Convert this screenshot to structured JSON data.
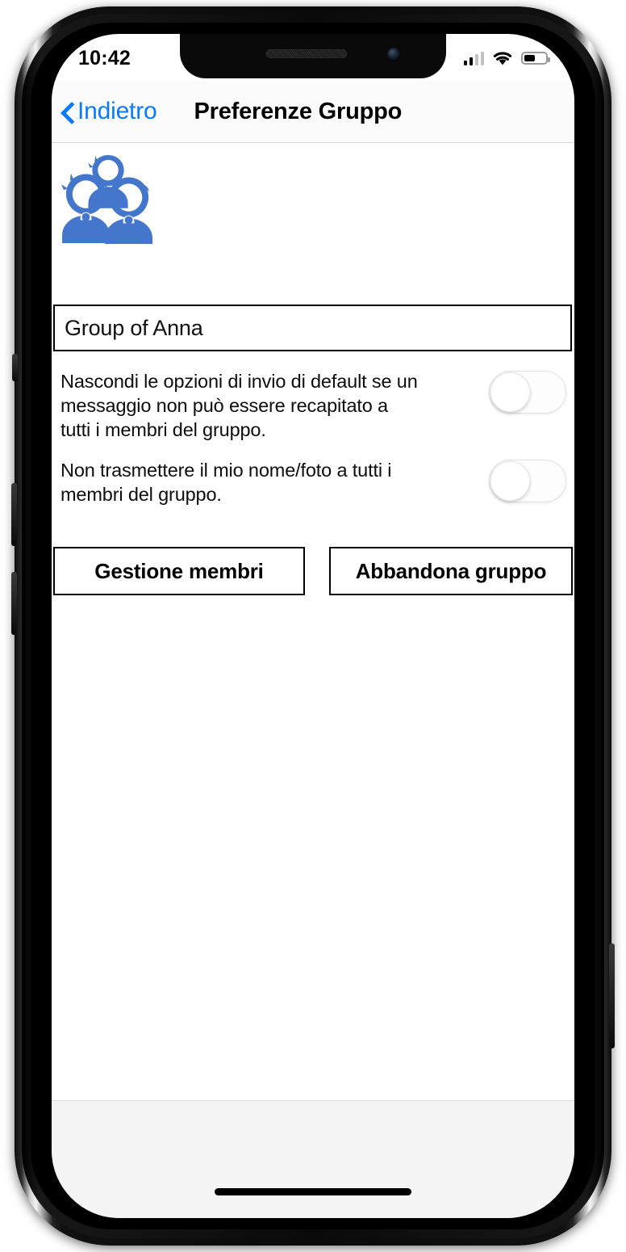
{
  "status_bar": {
    "time": "10:42",
    "signal_icon": "cellular-signal-icon",
    "signal_bars_total": 4,
    "signal_bars_filled": 2,
    "wifi_icon": "wifi-icon",
    "battery_icon": "battery-icon",
    "battery_level_percent": 45
  },
  "nav": {
    "back_icon": "chevron-left-icon",
    "back_label": "Indietro",
    "title": "Preferenze Gruppo"
  },
  "content": {
    "avatar_icon": "group-people-icon",
    "avatar_color": "#4477cc",
    "group_name_field": {
      "value": "Group of Anna",
      "placeholder": "Group of Anna"
    },
    "preferences": [
      {
        "label": "Nascondi le opzioni di invio di default se un\nmessaggio non può essere recapitato a\ntutti i membri del gruppo.",
        "toggle_state": "off"
      },
      {
        "label": "Non trasmettere il mio nome/foto a tutti i\nmembri del gruppo.",
        "toggle_state": "off"
      }
    ],
    "buttons": {
      "manage_members": "Gestione membri",
      "leave_group": "Abbandona gruppo"
    }
  },
  "colors": {
    "accent_blue": "#0a7aff",
    "avatar_blue": "#4477cc",
    "text_black": "#000000",
    "nav_background": "#fbfbfb",
    "safe_area": "#f4f4f4"
  }
}
